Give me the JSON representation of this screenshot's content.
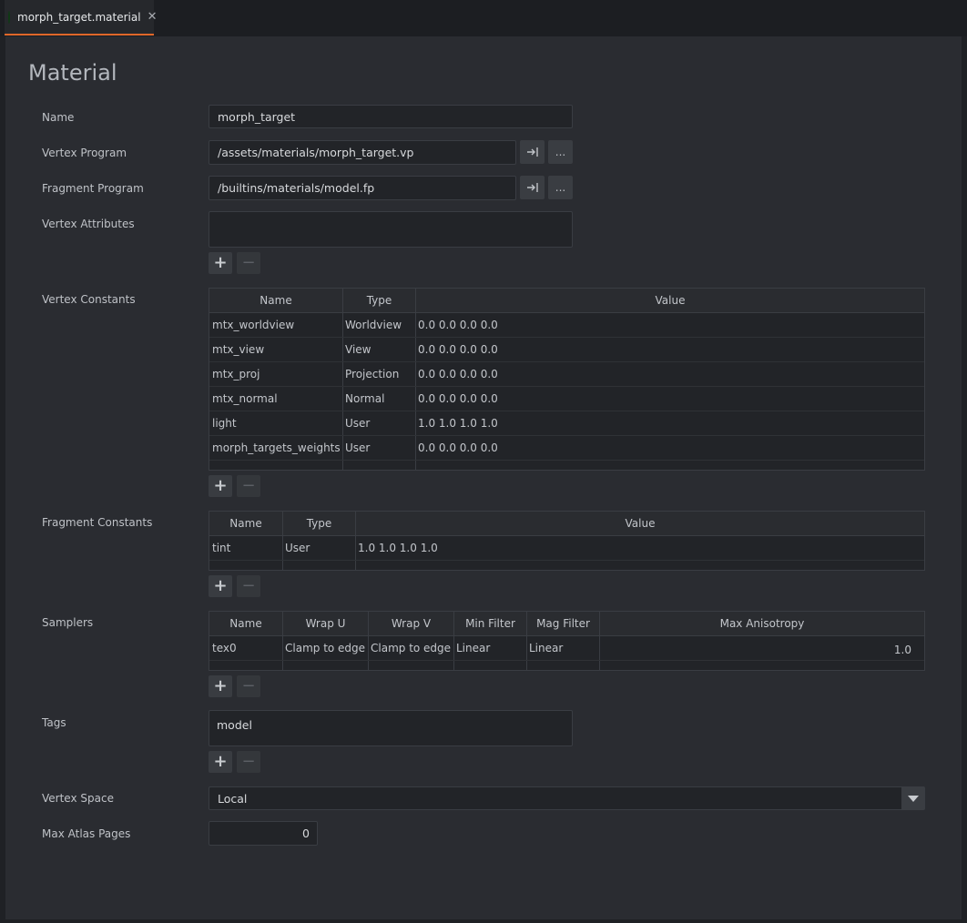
{
  "tab": {
    "label": "morph_target.material",
    "close": "✕"
  },
  "page_title": "Material",
  "labels": {
    "name": "Name",
    "vertex_program": "Vertex Program",
    "fragment_program": "Fragment Program",
    "vertex_attributes": "Vertex Attributes",
    "vertex_constants": "Vertex Constants",
    "fragment_constants": "Fragment Constants",
    "samplers": "Samplers",
    "tags": "Tags",
    "vertex_space": "Vertex Space",
    "max_atlas_pages": "Max Atlas Pages"
  },
  "fields": {
    "name": "morph_target",
    "vertex_program": "/assets/materials/morph_target.vp",
    "fragment_program": "/builtins/materials/model.fp",
    "vertex_space": "Local",
    "max_atlas_pages": "0"
  },
  "browse_label": "...",
  "add_label": "+",
  "remove_label": "−",
  "vertex_constants": {
    "columns": [
      "Name",
      "Type",
      "Value"
    ],
    "rows": [
      {
        "name": "mtx_worldview",
        "type": "Worldview",
        "value": "0.0  0.0  0.0  0.0"
      },
      {
        "name": "mtx_view",
        "type": "View",
        "value": "0.0  0.0  0.0  0.0"
      },
      {
        "name": "mtx_proj",
        "type": "Projection",
        "value": "0.0  0.0  0.0  0.0"
      },
      {
        "name": "mtx_normal",
        "type": "Normal",
        "value": "0.0  0.0  0.0  0.0"
      },
      {
        "name": "light",
        "type": "User",
        "value": "1.0  1.0  1.0  1.0"
      },
      {
        "name": "morph_targets_weights",
        "type": "User",
        "value": "0.0  0.0  0.0  0.0"
      }
    ]
  },
  "fragment_constants": {
    "columns": [
      "Name",
      "Type",
      "Value"
    ],
    "rows": [
      {
        "name": "tint",
        "type": "User",
        "value": "1.0  1.0  1.0  1.0"
      }
    ]
  },
  "samplers": {
    "columns": [
      "Name",
      "Wrap U",
      "Wrap V",
      "Min Filter",
      "Mag Filter",
      "Max Anisotropy"
    ],
    "rows": [
      {
        "name": "tex0",
        "wrap_u": "Clamp to edge",
        "wrap_v": "Clamp to edge",
        "min_filter": "Linear",
        "mag_filter": "Linear",
        "max_anisotropy": "1.0"
      }
    ]
  },
  "tags": [
    "model"
  ]
}
